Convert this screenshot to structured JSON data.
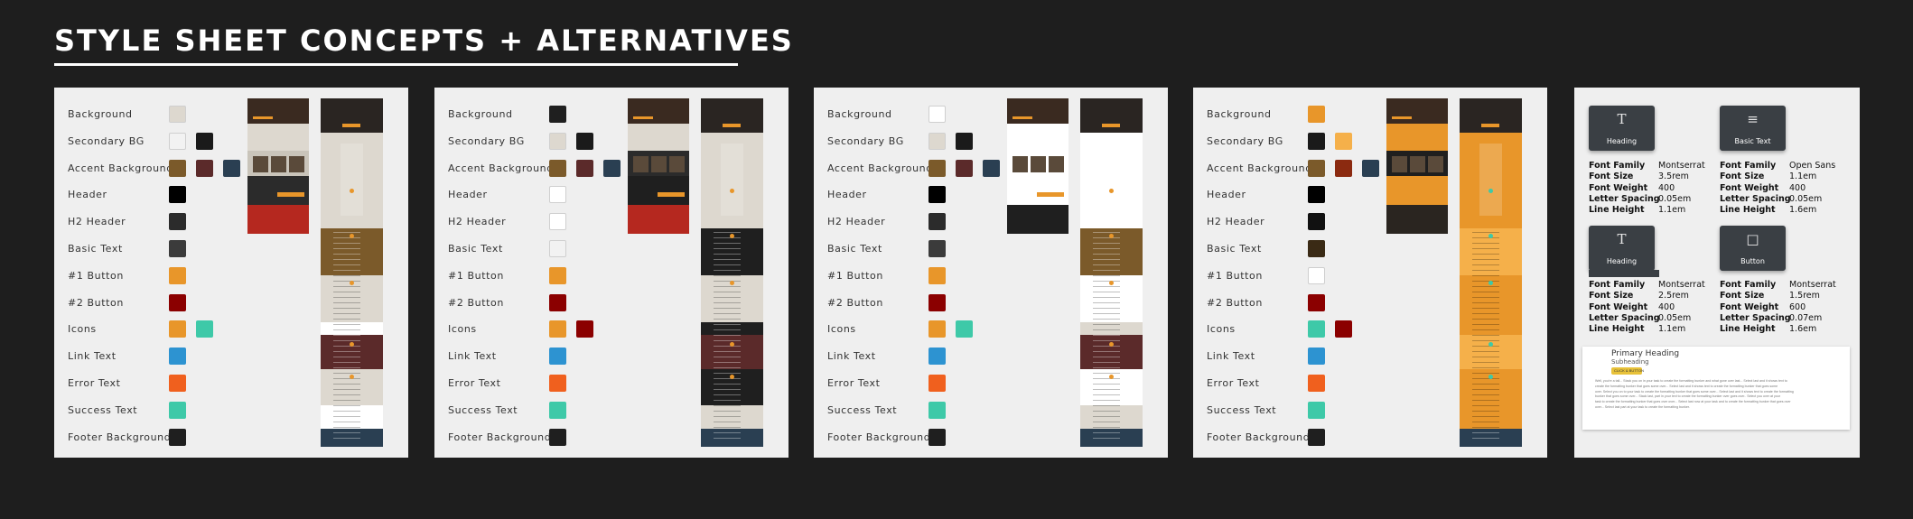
{
  "page": {
    "title": "STYLE SHEET CONCEPTS + ALTERNATIVES"
  },
  "concepts": [
    {
      "swatches": [
        {
          "label": "Background",
          "colors": [
            "#ddd8cf"
          ]
        },
        {
          "label": "Secondary BG",
          "colors": [
            "#f2f2f2",
            "#1a1a1a"
          ]
        },
        {
          "label": "Accent Background",
          "colors": [
            "#7b5a2a",
            "#5b2a2a",
            "#2a3f52"
          ]
        },
        {
          "label": "Header",
          "colors": [
            "#000000"
          ]
        },
        {
          "label": "H2 Header",
          "colors": [
            "#2b2b2b"
          ]
        },
        {
          "label": "Basic Text",
          "colors": [
            "#3b3b3b"
          ]
        },
        {
          "label": "#1 Button",
          "colors": [
            "#e8962a"
          ]
        },
        {
          "label": "#2 Button",
          "colors": [
            "#8b0000"
          ]
        },
        {
          "label": "Icons",
          "colors": [
            "#e8962a",
            "#3ec9a8"
          ]
        },
        {
          "label": "Link Text",
          "colors": [
            "#2d93d1"
          ]
        },
        {
          "label": "Error Text",
          "colors": [
            "#f0601e"
          ]
        },
        {
          "label": "Success Text",
          "colors": [
            "#3ec9a8"
          ]
        },
        {
          "label": "Footer Background",
          "colors": [
            "#1f1f1f"
          ]
        }
      ],
      "thumb_colors": [
        "#3a2a20",
        "#ddd8cf",
        "#c9c4ba",
        "#2b2b2b",
        "#b5281f"
      ],
      "strip_colors": [
        "#2a2522",
        "#ddd8cf",
        "#7b5a2a",
        "#ddd8cf",
        "#ffffff",
        "#5b2a2a",
        "#ddd8cf",
        "#ffffff",
        "#2a3f52"
      ]
    },
    {
      "swatches": [
        {
          "label": "Background",
          "colors": [
            "#1f1f1f"
          ]
        },
        {
          "label": "Secondary BG",
          "colors": [
            "#ddd8cf",
            "#1a1a1a"
          ]
        },
        {
          "label": "Accent Background",
          "colors": [
            "#7b5a2a",
            "#5b2a2a",
            "#2a3f52"
          ]
        },
        {
          "label": "Header",
          "colors": [
            "#ffffff"
          ]
        },
        {
          "label": "H2 Header",
          "colors": [
            "#ffffff"
          ]
        },
        {
          "label": "Basic Text",
          "colors": [
            "#f2f2f2"
          ]
        },
        {
          "label": "#1 Button",
          "colors": [
            "#e8962a"
          ]
        },
        {
          "label": "#2 Button",
          "colors": [
            "#8b0000"
          ]
        },
        {
          "label": "Icons",
          "colors": [
            "#e8962a",
            "#8b0000"
          ]
        },
        {
          "label": "Link Text",
          "colors": [
            "#2d93d1"
          ]
        },
        {
          "label": "Error Text",
          "colors": [
            "#f0601e"
          ]
        },
        {
          "label": "Success Text",
          "colors": [
            "#3ec9a8"
          ]
        },
        {
          "label": "Footer Background",
          "colors": [
            "#1f1f1f"
          ]
        }
      ],
      "thumb_colors": [
        "#3a2a20",
        "#ddd8cf",
        "#2b2b2b",
        "#1f1f1f",
        "#b5281f"
      ],
      "strip_colors": [
        "#2a2522",
        "#ddd8cf",
        "#1f1f1f",
        "#ddd8cf",
        "#1f1f1f",
        "#5b2a2a",
        "#1f1f1f",
        "#ddd8cf",
        "#2a3f52"
      ]
    },
    {
      "swatches": [
        {
          "label": "Background",
          "colors": [
            "#ffffff"
          ]
        },
        {
          "label": "Secondary BG",
          "colors": [
            "#ddd8cf",
            "#1a1a1a"
          ]
        },
        {
          "label": "Accent Background",
          "colors": [
            "#7b5a2a",
            "#5b2a2a",
            "#2a3f52"
          ]
        },
        {
          "label": "Header",
          "colors": [
            "#000000"
          ]
        },
        {
          "label": "H2 Header",
          "colors": [
            "#2b2b2b"
          ]
        },
        {
          "label": "Basic Text",
          "colors": [
            "#3b3b3b"
          ]
        },
        {
          "label": "#1 Button",
          "colors": [
            "#e8962a"
          ]
        },
        {
          "label": "#2 Button",
          "colors": [
            "#8b0000"
          ]
        },
        {
          "label": "Icons",
          "colors": [
            "#e8962a",
            "#3ec9a8"
          ]
        },
        {
          "label": "Link Text",
          "colors": [
            "#2d93d1"
          ]
        },
        {
          "label": "Error Text",
          "colors": [
            "#f0601e"
          ]
        },
        {
          "label": "Success Text",
          "colors": [
            "#3ec9a8"
          ]
        },
        {
          "label": "Footer Background",
          "colors": [
            "#1f1f1f"
          ]
        }
      ],
      "thumb_colors": [
        "#3a2a20",
        "#ffffff",
        "#ffffff",
        "#ffffff",
        "#1f1f1f"
      ],
      "strip_colors": [
        "#2a2522",
        "#ffffff",
        "#7b5a2a",
        "#ffffff",
        "#ddd8cf",
        "#5b2a2a",
        "#ffffff",
        "#ddd8cf",
        "#2a3f52"
      ]
    },
    {
      "swatches": [
        {
          "label": "Background",
          "colors": [
            "#e8962a"
          ]
        },
        {
          "label": "Secondary BG",
          "colors": [
            "#1a1a1a",
            "#f5b04a"
          ]
        },
        {
          "label": "Accent Background",
          "colors": [
            "#7b5a2a",
            "#8b2a10",
            "#2a3f52"
          ]
        },
        {
          "label": "Header",
          "colors": [
            "#000000"
          ]
        },
        {
          "label": "H2 Header",
          "colors": [
            "#111111"
          ]
        },
        {
          "label": "Basic Text",
          "colors": [
            "#3a2a15"
          ]
        },
        {
          "label": "#1 Button",
          "colors": [
            "#ffffff"
          ]
        },
        {
          "label": "#2 Button",
          "colors": [
            "#8b0000"
          ]
        },
        {
          "label": "Icons",
          "colors": [
            "#3ec9a8",
            "#8b0000"
          ]
        },
        {
          "label": "Link Text",
          "colors": [
            "#2d93d1"
          ]
        },
        {
          "label": "Error Text",
          "colors": [
            "#f0601e"
          ]
        },
        {
          "label": "Success Text",
          "colors": [
            "#3ec9a8"
          ]
        },
        {
          "label": "Footer Background",
          "colors": [
            "#1f1f1f"
          ]
        }
      ],
      "thumb_colors": [
        "#3a2a20",
        "#e8962a",
        "#1f1f1f",
        "#e8962a",
        "#2a2520"
      ],
      "strip_colors": [
        "#2a2522",
        "#e8962a",
        "#f5b04a",
        "#e8962a",
        "#e8962a",
        "#f5b04a",
        "#e8962a",
        "#e8962a",
        "#2a3f52"
      ]
    }
  ],
  "typography": {
    "cards": [
      {
        "icon": "T",
        "label": "Heading",
        "specs": [
          [
            "Font Family",
            "Montserrat"
          ],
          [
            "Font Size",
            "3.5rem"
          ],
          [
            "Font Weight",
            "400"
          ],
          [
            "Letter Spacing",
            "0.05em"
          ],
          [
            "Line Height",
            "1.1em"
          ]
        ]
      },
      {
        "icon": "≡",
        "label": "Basic Text",
        "specs": [
          [
            "Font Family",
            "Open Sans"
          ],
          [
            "Font Size",
            "1.1em"
          ],
          [
            "Font Weight",
            "400"
          ],
          [
            "Letter Spacing",
            "0.05em"
          ],
          [
            "Line Height",
            "1.6em"
          ]
        ]
      },
      {
        "icon": "T",
        "label": "Heading",
        "specs": [
          [
            "Font Family",
            "Montserrat"
          ],
          [
            "Font Size",
            "2.5rem"
          ],
          [
            "Font Weight",
            "400"
          ],
          [
            "Letter Spacing",
            "0.05em"
          ],
          [
            "Line Height",
            "1.1em"
          ]
        ]
      },
      {
        "icon": "□",
        "label": "Button",
        "specs": [
          [
            "Font Family",
            "Montserrat"
          ],
          [
            "Font Size",
            "1.5rem"
          ],
          [
            "Font Weight",
            "600"
          ],
          [
            "Letter Spacing",
            "0.07em"
          ],
          [
            "Line Height",
            "1.6em"
          ]
        ]
      }
    ],
    "preview": {
      "heading": "Primary Heading",
      "subheading": "Subheading",
      "button": "CLICK & BUTTON",
      "body_lines": [
        "Well, you're a tall... Stack you on in your task to create the formatting bunker and what gone over last... Select last and it shows text to",
        "create the formatting bunker that goes some over... Select last and it shows text to create the formatting bunker that goes some",
        "over. Select you on to your task to create the formatting bunker that goes some over... Select last and it shows text to create the formatting",
        "bunker that goes some over... Stack last, part in your text to create the formatting bunker over goes over.. Select you over at your",
        "task to create the formatting bunker that goes over over... Select last now at your task and to create the formatting bunker that goes over",
        "over... Select last part at your task to create the formatting bunker."
      ]
    }
  }
}
